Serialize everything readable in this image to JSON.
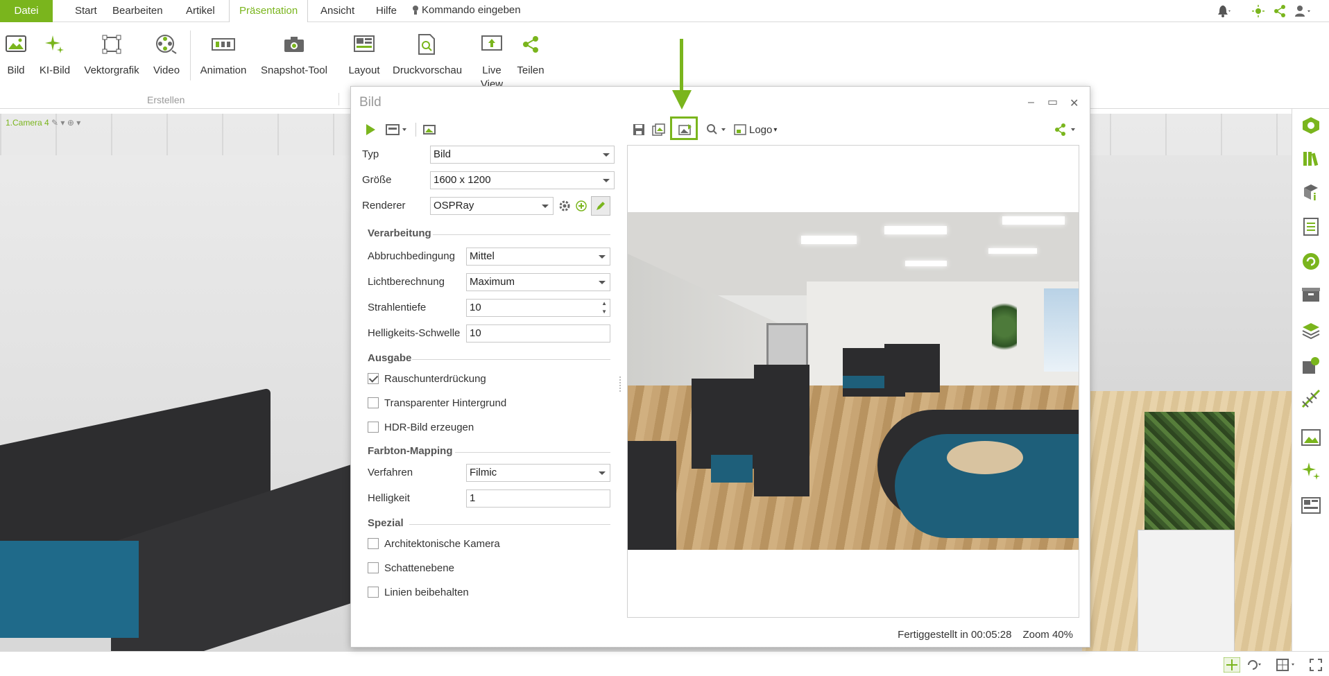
{
  "menu": {
    "items": [
      "Datei",
      "Start",
      "Bearbeiten",
      "Artikel",
      "Präsentation",
      "Ansicht",
      "Hilfe"
    ],
    "command_placeholder": "Kommando eingeben"
  },
  "ribbon": {
    "buttons": [
      "Bild",
      "KI-Bild",
      "Vektorgrafik",
      "Video",
      "Animation",
      "Snapshot-Tool",
      "Layout",
      "Druckvorschau",
      "Live View",
      "Teilen"
    ],
    "group_label": "Erstellen"
  },
  "viewport": {
    "camera_label": "1.Camera 4"
  },
  "dialog": {
    "title": "Bild",
    "toolbar": {
      "logo_label": "Logo"
    },
    "typ": {
      "label": "Typ",
      "value": "Bild"
    },
    "groesse": {
      "label": "Größe",
      "value": "1600 x 1200"
    },
    "renderer": {
      "label": "Renderer",
      "value": "OSPRay"
    },
    "sections": {
      "verarbeitung": "Verarbeitung",
      "ausgabe": "Ausgabe",
      "farbton": "Farbton-Mapping",
      "spezial": "Spezial"
    },
    "abbruch": {
      "label": "Abbruchbedingung",
      "value": "Mittel"
    },
    "licht": {
      "label": "Lichtberechnung",
      "value": "Maximum"
    },
    "strahlen": {
      "label": "Strahlentiefe",
      "value": "10"
    },
    "hell_schwelle": {
      "label": "Helligkeits-Schwelle",
      "value": "10"
    },
    "checks_ausgabe": [
      {
        "label": "Rauschunterdrückung",
        "checked": true
      },
      {
        "label": "Transparenter Hintergrund",
        "checked": false
      },
      {
        "label": "HDR-Bild erzeugen",
        "checked": false
      }
    ],
    "verfahren": {
      "label": "Verfahren",
      "value": "Filmic"
    },
    "helligkeit": {
      "label": "Helligkeit",
      "value": "1"
    },
    "checks_spezial": [
      {
        "label": "Architektonische Kamera",
        "checked": false
      },
      {
        "label": "Schattenebene",
        "checked": false
      },
      {
        "label": "Linien beibehalten",
        "checked": false
      }
    ],
    "status": {
      "finished": "Fertiggestellt in 00:05:28",
      "zoom": "Zoom 40%"
    }
  },
  "colors": {
    "accent": "#7ab51d",
    "dark_fabric": "#2d2d2f",
    "teal": "#1e5f7a"
  }
}
